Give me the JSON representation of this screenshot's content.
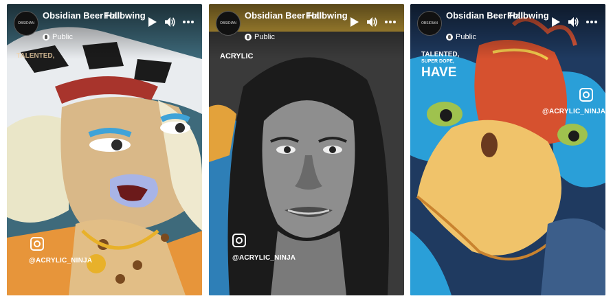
{
  "posts": [
    {
      "page_name": "Obsidian Beer Hall",
      "follow_status": "Following",
      "privacy": "Public",
      "avatar_text": "OBSIDIAN",
      "overlay_top": "TALENTED,",
      "handle": "@ACRYLIC_NINJA",
      "icons": [
        "play-icon",
        "volume-icon",
        "more-options-icon",
        "instagram-icon"
      ]
    },
    {
      "page_name": "Obsidian Beer Hall",
      "follow_status": "Following",
      "privacy": "Public",
      "avatar_text": "OBSIDIAN",
      "overlay_top": "ACRYLIC",
      "handle": "@ACRYLIC_NINJA",
      "icons": [
        "play-icon",
        "volume-icon",
        "more-options-icon",
        "instagram-icon"
      ]
    },
    {
      "page_name": "Obsidian Beer Hall",
      "follow_status": "Following",
      "privacy": "Public",
      "avatar_text": "OBSIDIAN",
      "overlay_line1": "TALENTED,",
      "overlay_line2": "SUPER DOPE,",
      "overlay_line3": "HAVE",
      "handle": "@ACRYLIC_NINJA",
      "icons": [
        "play-icon",
        "volume-icon",
        "more-options-icon",
        "instagram-icon"
      ]
    }
  ]
}
